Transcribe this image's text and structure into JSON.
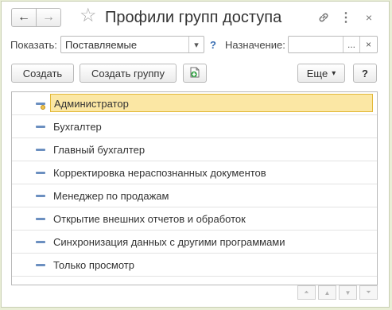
{
  "window": {
    "title": "Профили групп доступа",
    "back_icon": "←",
    "forward_icon": "→",
    "favorite_icon": "☆",
    "more_icon": "⋮",
    "close_icon": "×"
  },
  "filters": {
    "show_label": "Показать:",
    "show_value": "Поставляемые",
    "show_dropdown_icon": "▾",
    "help_icon": "?",
    "purpose_label": "Назначение:",
    "purpose_value": "",
    "purpose_select_icon": "...",
    "purpose_clear_icon": "×"
  },
  "toolbar": {
    "create": "Создать",
    "create_group": "Создать группу",
    "more": "Еще",
    "more_arrow": "▾",
    "help": "?"
  },
  "list": {
    "items": [
      {
        "label": "Администратор",
        "selected": true
      },
      {
        "label": "Бухгалтер"
      },
      {
        "label": "Главный бухгалтер"
      },
      {
        "label": "Корректировка нераспознанных документов"
      },
      {
        "label": "Менеджер по продажам"
      },
      {
        "label": "Открытие внешних отчетов и обработок"
      },
      {
        "label": "Синхронизация данных с другими программами"
      },
      {
        "label": "Только просмотр"
      }
    ]
  },
  "pager": {
    "first": "⏶",
    "up": "▲",
    "down": "▼",
    "last": "⏷"
  },
  "colors": {
    "selection_fill": "#fbe7a4",
    "selection_border": "#e2b838",
    "item_marker": "#6b8fc0",
    "help_blue": "#3a6fb3"
  }
}
